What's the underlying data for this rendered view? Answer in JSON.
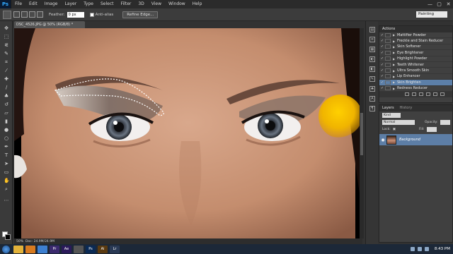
{
  "app": {
    "logo": "Ps"
  },
  "menubar": {
    "items": [
      "File",
      "Edit",
      "Image",
      "Layer",
      "Type",
      "Select",
      "Filter",
      "3D",
      "View",
      "Window",
      "Help"
    ],
    "window_controls": [
      "—",
      "▢",
      "✕"
    ]
  },
  "options": {
    "feather_label": "Feather:",
    "feather_value": "0 px",
    "antialias_label": "Anti-alias",
    "refine_button": "Refine Edge...",
    "workspace": "Painting"
  },
  "document": {
    "tab_title": "DSC_4526.JPG @ 50% (RGB/8) *",
    "zoom": "50%",
    "doc_size": "Doc: 24.9M/24.9M"
  },
  "actions_panel": {
    "tab": "Actions",
    "items": [
      {
        "label": "Mattifier Powder"
      },
      {
        "label": "Freckle and Stain Reducer"
      },
      {
        "label": "Skin Softener"
      },
      {
        "label": "Eye Brightener"
      },
      {
        "label": "Highlight Powder"
      },
      {
        "label": "Teeth Whitener"
      },
      {
        "label": "Ultra Smooth Skin"
      },
      {
        "label": "Lip Enhancer"
      },
      {
        "label": "Skin Brighten"
      },
      {
        "label": "Redness Reducer"
      }
    ],
    "selected_index": 8
  },
  "layers_panel": {
    "tabs": [
      "Layers",
      "History"
    ],
    "kind_label": "Kind",
    "blend_mode": "Normal",
    "opacity_label": "Opacity:",
    "lock_label": "Lock:",
    "fill_label": "Fill:",
    "layer_name": "Background"
  },
  "taskbar": {
    "apps": [
      {
        "icon": "folder-icon",
        "color": "#e2b23a"
      },
      {
        "icon": "media-icon",
        "color": "#d77a1f"
      },
      {
        "icon": "browser-icon",
        "color": "#3d7fd0"
      },
      {
        "icon": "premiere-icon",
        "color": "#3b2a6e",
        "text": "Pr"
      },
      {
        "icon": "after-effects-icon",
        "color": "#2b1a5a",
        "text": "Ae"
      },
      {
        "icon": "app-icon",
        "color": "#555555"
      },
      {
        "icon": "photoshop-icon",
        "color": "#0a2a55",
        "text": "Ps"
      },
      {
        "icon": "illustrator-icon",
        "color": "#5a3a10",
        "text": "Ai"
      },
      {
        "icon": "lightroom-icon",
        "color": "#2a3a55",
        "text": "Lr"
      }
    ],
    "time": "8:43 PM"
  },
  "colors": {
    "selected_row": "#5c7fa8",
    "brush": "#f0b400"
  }
}
